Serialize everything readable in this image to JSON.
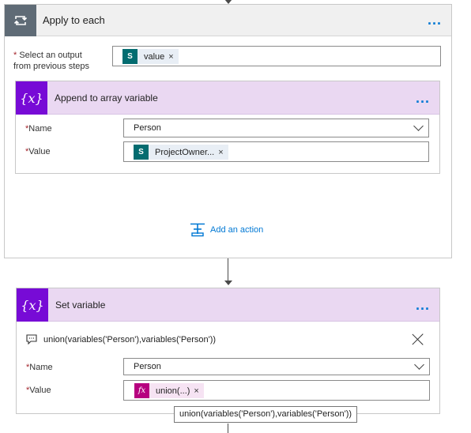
{
  "apply_to_each": {
    "title": "Apply to each",
    "select_output_label_line1": "Select an output",
    "select_output_label_line2": "from previous steps",
    "required_mark": "*",
    "token_value": "value",
    "token_remove": "×",
    "more": "..."
  },
  "append_to_array": {
    "title": "Append to array variable",
    "icon_text": "{x}",
    "more": "...",
    "name_label": "Name",
    "name_value": "Person",
    "value_label": "Value",
    "value_token": "ProjectOwner...",
    "value_token_remove": "×"
  },
  "add_action": {
    "label": "Add an action"
  },
  "set_variable": {
    "title": "Set variable",
    "icon_text": "{x}",
    "more": "...",
    "comment": "union(variables('Person'),variables('Person'))",
    "name_label": "Name",
    "name_value": "Person",
    "value_label": "Value",
    "value_token": "union(...)",
    "value_token_icon": "fx",
    "value_token_remove": "×"
  },
  "tooltip": {
    "text": "union(variables('Person'),variables('Person'))"
  },
  "icons": {
    "loop": "loop-icon",
    "sharepoint": "sharepoint-icon",
    "variable": "variable-icon",
    "add_action": "add-action-icon",
    "comment": "comment-icon",
    "close": "close-icon",
    "expression": "expression-icon"
  },
  "colors": {
    "loop_icon_bg": "#5f6b76",
    "variable_icon_bg": "#770bd6",
    "variable_header_bg": "#ead8f2",
    "sharepoint": "#036c70",
    "expression": "#b6007f",
    "link": "#0078d4",
    "required": "#a4262c"
  }
}
